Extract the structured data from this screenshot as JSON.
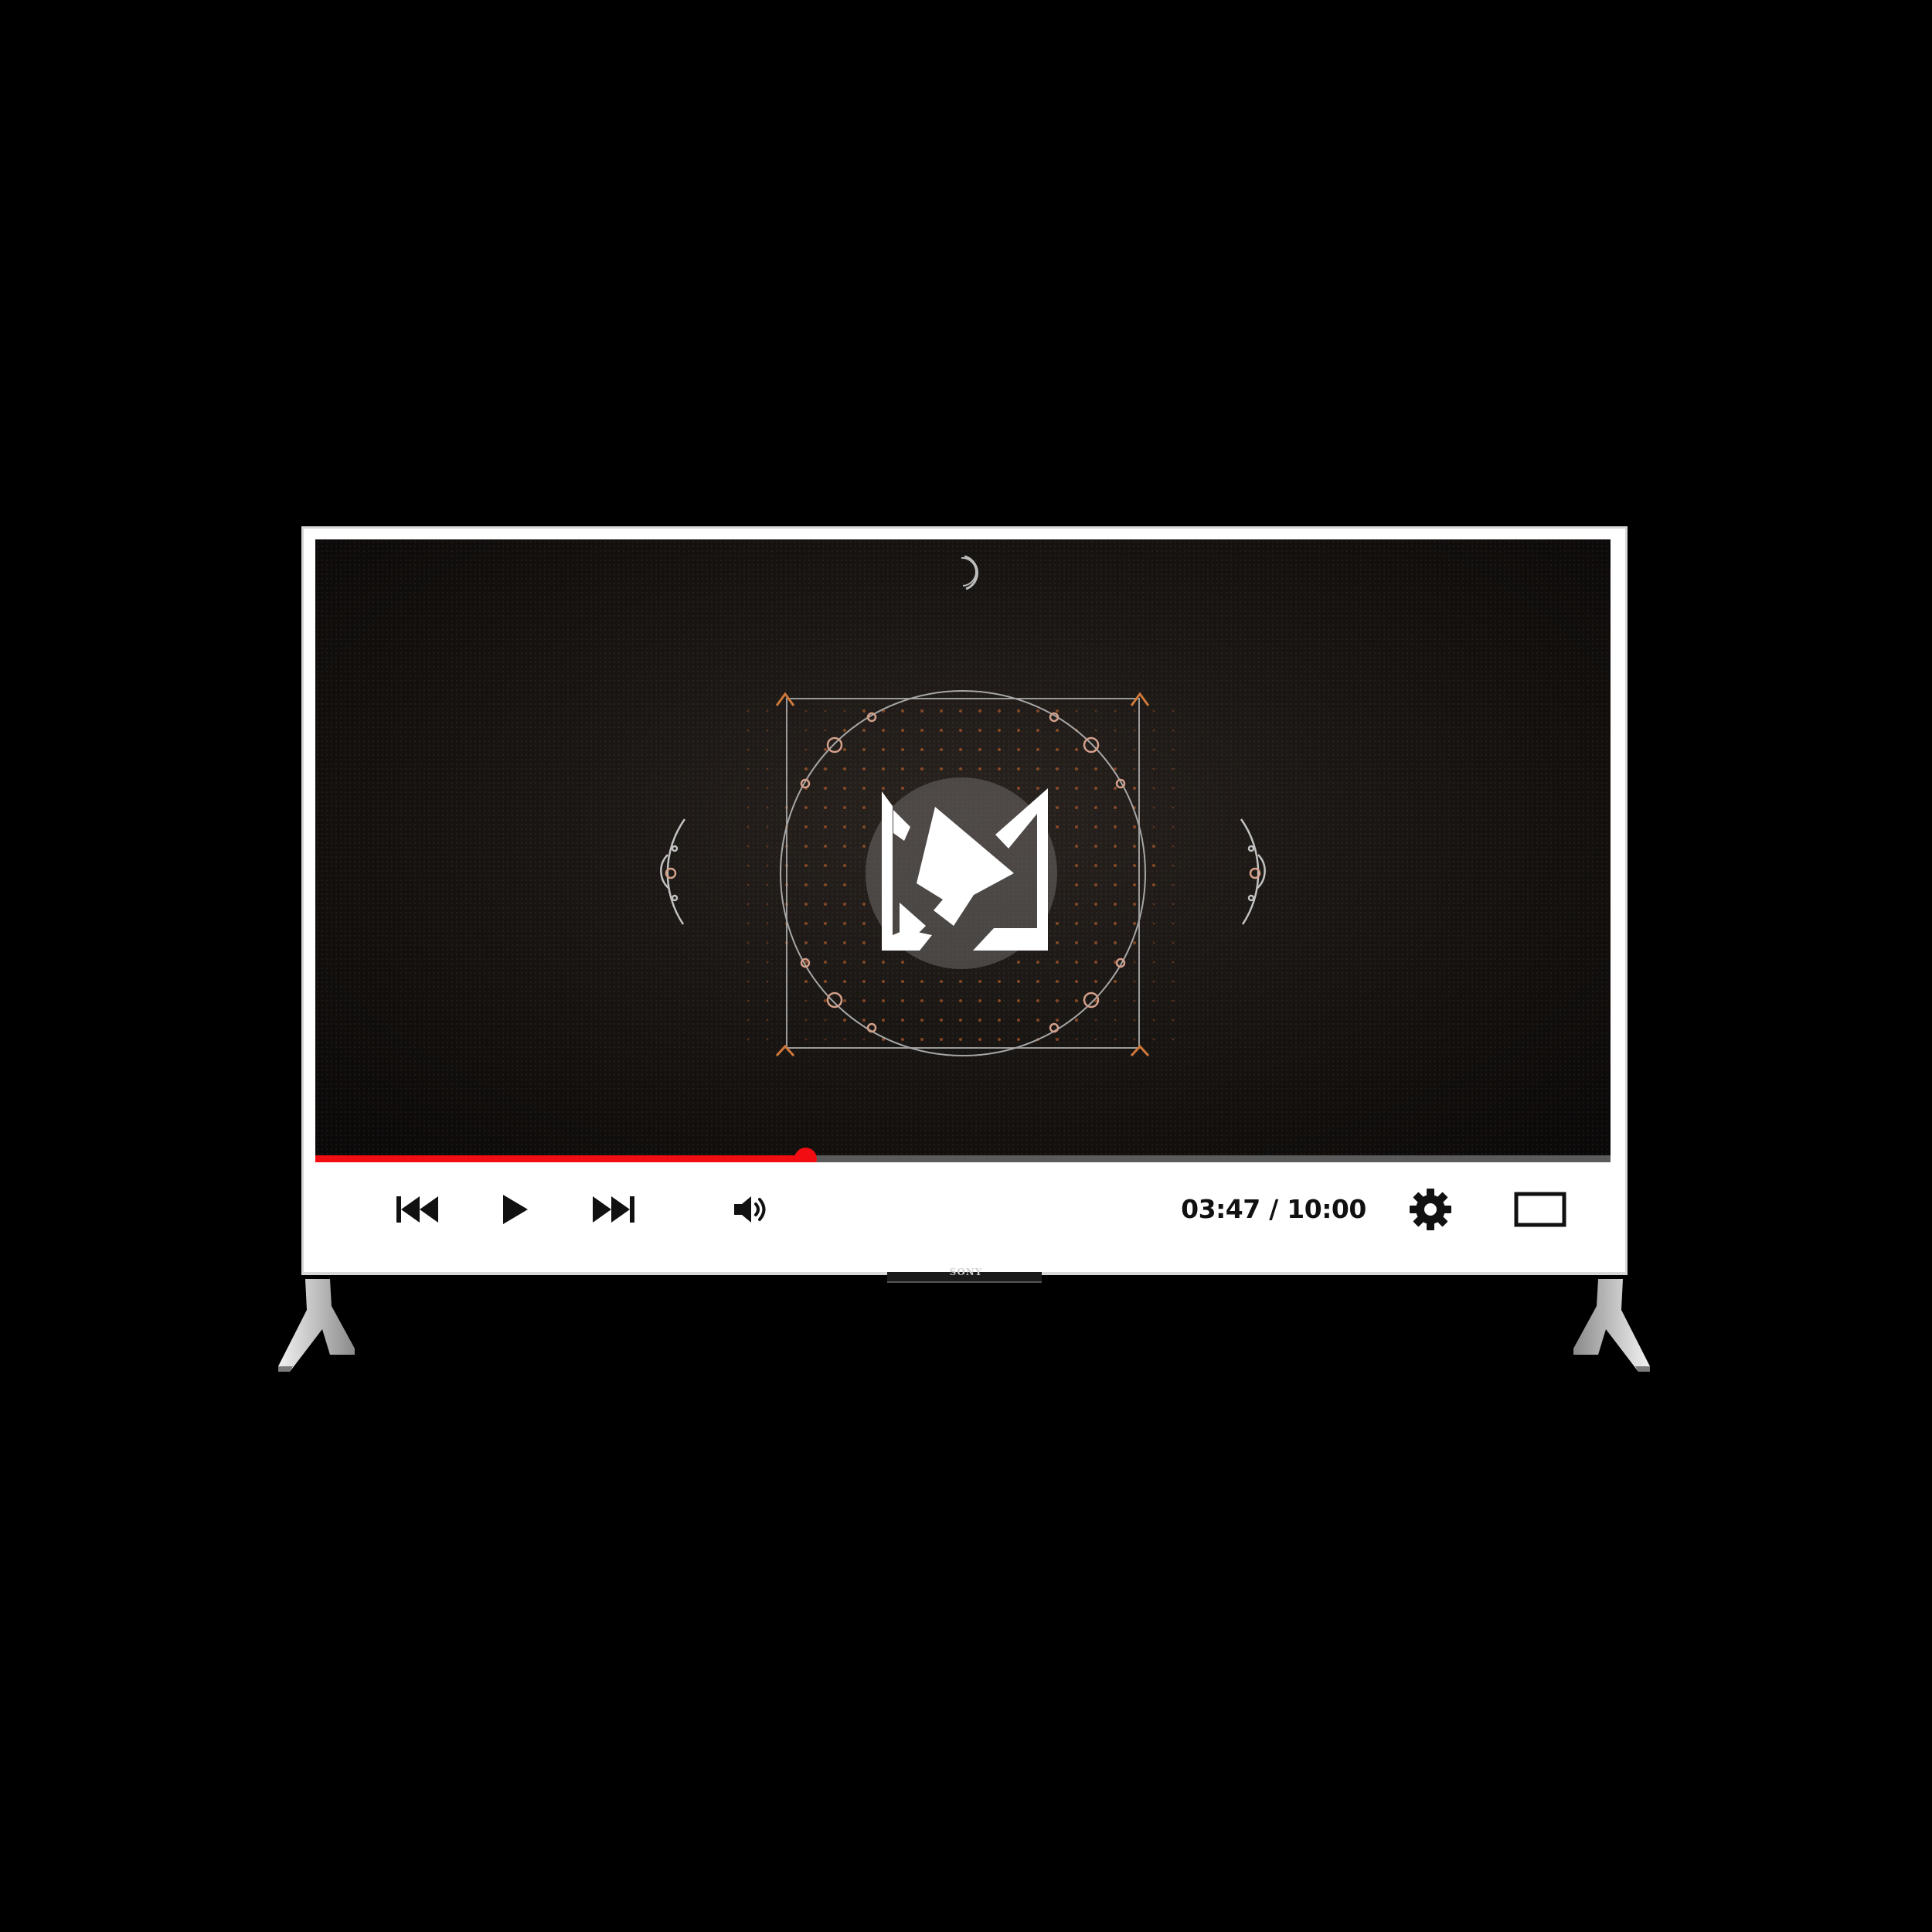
{
  "device": {
    "brand": "SONY"
  },
  "player": {
    "current_time": "03:47",
    "separator": "/",
    "duration": "10:00",
    "progress_fraction": 0.3783,
    "accent_color": "#f10d12",
    "track_color": "#5b5b5b"
  },
  "controls": {
    "previous": "skip-previous-icon",
    "play": "play-icon",
    "next": "skip-next-icon",
    "volume": "volume-icon",
    "settings": "gear-icon",
    "screen": "theater-mode-icon"
  },
  "video": {
    "logo": "brand-logo-emblem"
  }
}
